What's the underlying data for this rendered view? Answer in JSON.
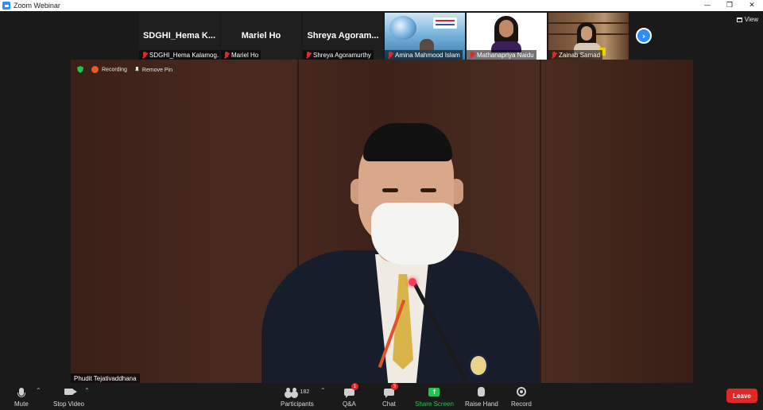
{
  "window": {
    "title": "Zoom Webinar",
    "controls": {
      "minimize": "—",
      "restore": "❐",
      "close": "✕"
    }
  },
  "view_button": {
    "label": "View"
  },
  "thumbnails": [
    {
      "display_name": "SDGHI_Hema  K...",
      "label": "SDGHI_Hema Kalamog...",
      "muted": true,
      "video": false
    },
    {
      "display_name": "Mariel Ho",
      "label": "Mariel Ho",
      "muted": true,
      "video": false
    },
    {
      "display_name": "Shreya  Agoram...",
      "label": "Shreya Agoramurthy",
      "muted": true,
      "video": false
    },
    {
      "label": "Amina Mahmood Islam",
      "muted": true,
      "video": true
    },
    {
      "label": "Mathanapriya Naidu",
      "muted": true,
      "video": true
    },
    {
      "label": "Zainab Samad",
      "muted": true,
      "video": true
    }
  ],
  "next_page_icon": "chevron-right-icon",
  "indicators": {
    "recording": "Recording",
    "remove_pin": "Remove Pin"
  },
  "active_speaker": {
    "name": "Phudit Tejativaddhana"
  },
  "toolbar": {
    "mute": "Mute",
    "stop_video": "Stop Video",
    "participants": "Participants",
    "participants_count": "182",
    "qa": "Q&A",
    "qa_badge": "1",
    "chat": "Chat",
    "chat_badge": "3",
    "share_screen": "Share Screen",
    "raise_hand": "Raise Hand",
    "record": "Record",
    "leave": "Leave"
  },
  "colors": {
    "accent_blue": "#2d8cff",
    "share_green": "#23c552",
    "leave_red": "#e02828"
  }
}
